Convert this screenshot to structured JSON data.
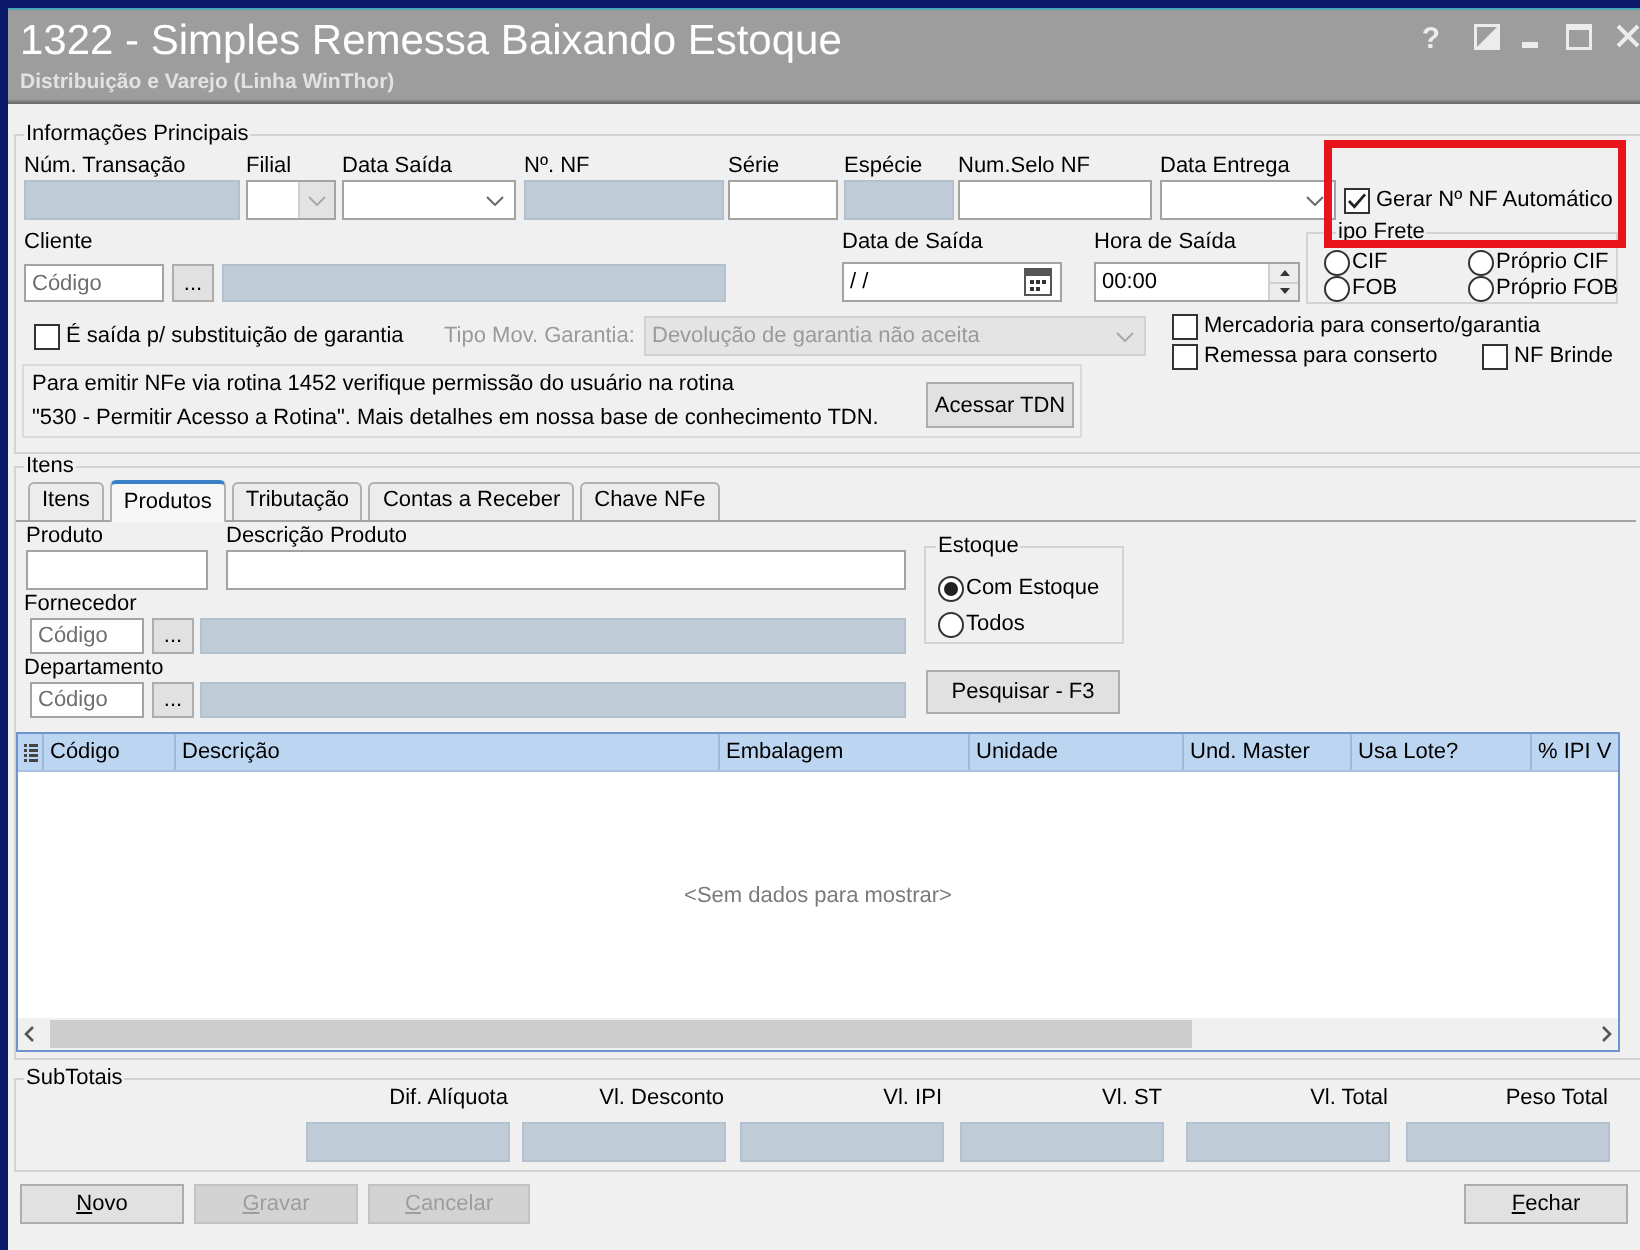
{
  "window": {
    "title": "1322 - Simples Remessa Baixando Estoque",
    "subtitle": "Distribuição e Varejo (Linha WinThor)",
    "controls": [
      {
        "kind": "help",
        "label": "?"
      },
      {
        "kind": "contrast"
      },
      {
        "kind": "minimize"
      },
      {
        "kind": "maximize"
      },
      {
        "kind": "close"
      }
    ]
  },
  "main_info": {
    "title": "Informações Principais",
    "fields": [
      {
        "label": "Núm. Transação",
        "kind": "readonly"
      },
      {
        "label": "Filial",
        "kind": "combo",
        "disabled": true
      },
      {
        "label": "Data Saída",
        "kind": "combo",
        "disabled": false
      },
      {
        "label": "Nº. NF",
        "kind": "readonly"
      },
      {
        "label": "Série",
        "kind": "text"
      },
      {
        "label": "Espécie",
        "kind": "readonly"
      },
      {
        "label": "Num.Selo NF",
        "kind": "text"
      },
      {
        "label": "Data Entrega",
        "kind": "combo",
        "disabled": false
      }
    ],
    "auto_nf": {
      "label": "Gerar Nº NF Automático",
      "checked": true,
      "highlighted": true
    },
    "client": {
      "label": "Cliente",
      "code_placeholder": "Código",
      "lookup_button": "..."
    },
    "exit_date": {
      "label": "Data de Saída",
      "value": "/ /"
    },
    "exit_time": {
      "label": "Hora de Saída",
      "value": "00:00"
    },
    "freight": {
      "title": "ipo Frete",
      "options": [
        {
          "label": "CIF",
          "selected": false
        },
        {
          "label": "Próprio CIF",
          "selected": false
        },
        {
          "label": "FOB",
          "selected": false
        },
        {
          "label": "Próprio FOB",
          "selected": false
        }
      ]
    },
    "warranty_replacement": {
      "label": "É saída p/ substituição de garantia",
      "checked": false
    },
    "warranty_type": {
      "label": "Tipo Mov. Garantia:",
      "value": "Devolução de garantia não aceita",
      "disabled": true
    },
    "repair_goods": {
      "label": "Mercadoria para conserto/garantia",
      "checked": false
    },
    "repair_shipment": {
      "label": "Remessa para conserto",
      "checked": false
    },
    "gift_nf": {
      "label": "NF Brinde",
      "checked": false
    },
    "notice": {
      "text": "Para emitir NFe via rotina 1452 verifique permissão do usuário na rotina\n\"530 - Permitir Acesso a Rotina\". Mais detalhes em nossa base de conhecimento TDN.",
      "button": "Acessar TDN"
    }
  },
  "items": {
    "title": "Itens",
    "tabs": [
      {
        "label": "Itens",
        "selected": false
      },
      {
        "label": "Produtos",
        "selected": true
      },
      {
        "label": "Tributação",
        "selected": false
      },
      {
        "label": "Contas a Receber",
        "selected": false
      },
      {
        "label": "Chave NFe",
        "selected": false
      }
    ],
    "product": {
      "label": "Produto"
    },
    "description": {
      "label": "Descrição Produto"
    },
    "supplier": {
      "label": "Fornecedor",
      "code_placeholder": "Código",
      "lookup_button": "..."
    },
    "department": {
      "label": "Departamento",
      "code_placeholder": "Código",
      "lookup_button": "..."
    },
    "stock": {
      "title": "Estoque",
      "options": [
        {
          "label": "Com Estoque",
          "selected": true
        },
        {
          "label": "Todos",
          "selected": false
        }
      ]
    },
    "search_button": "Pesquisar - F3",
    "table": {
      "columns": [
        "Código",
        "Descrição",
        "Embalagem",
        "Unidade",
        "Und. Master",
        "Usa Lote?",
        "% IPI V"
      ],
      "empty_text": "<Sem dados para mostrar>"
    }
  },
  "subtotals": {
    "title": "SubTotais",
    "fields": [
      {
        "label": "Dif. Alíquota"
      },
      {
        "label": "Vl. Desconto"
      },
      {
        "label": "Vl. IPI"
      },
      {
        "label": "Vl. ST"
      },
      {
        "label": "Vl. Total"
      },
      {
        "label": "Peso Total"
      }
    ]
  },
  "actions": [
    {
      "label": "Novo",
      "disabled": false,
      "mnemonic": true
    },
    {
      "label": "Gravar",
      "disabled": true,
      "mnemonic": true
    },
    {
      "label": "Cancelar",
      "disabled": true,
      "mnemonic": true
    }
  ],
  "close_button": {
    "label": "Fechar",
    "disabled": false,
    "mnemonic": true
  }
}
